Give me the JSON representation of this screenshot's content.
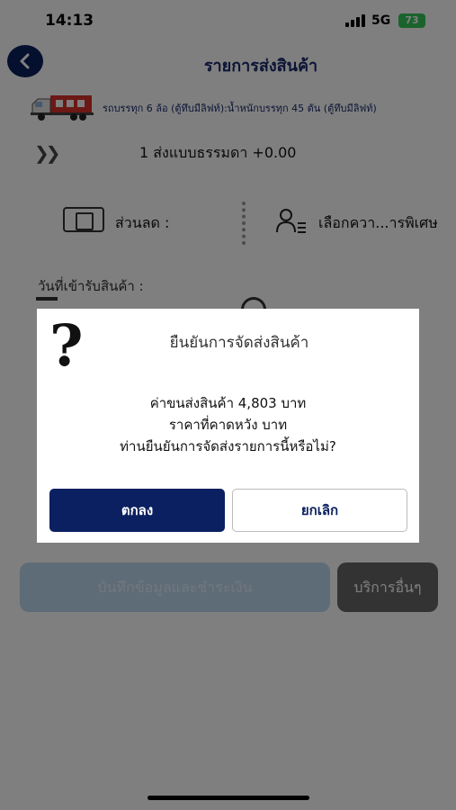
{
  "status": {
    "time": "14:13",
    "network": "5G",
    "battery": "73"
  },
  "header": {
    "title": "รายการส่งสินค้า"
  },
  "vehicle": {
    "description": "รถบรรทุก 6 ล้อ (ตู้ทึบมีลิฟท์):น้ำหนักบรรทุก 45 ตัน (ตู้ทึบมีลิฟท์)"
  },
  "delivery": {
    "option": "1 ส่งแบบธรรมดา +0.00"
  },
  "discount": {
    "label": "ส่วนลด :"
  },
  "options": {
    "label": "เลือกควา...ารพิเศษ"
  },
  "pickup": {
    "label": "วันที่เข้ารับสินค้า :"
  },
  "buttons": {
    "save_pay": "บันทึกข้อมูลและชำระเงิน",
    "other": "บริการอื่นๆ"
  },
  "dialog": {
    "icon": "?",
    "title": "ยืนยันการจัดส่งสินค้า",
    "line1": "ค่าขนส่งสินค้า 4,803 บาท",
    "line2": "ราคาที่คาดหวัง  บาท",
    "line3": "ท่านยืนยันการจัดส่งรายการนี้หรือไม่?",
    "ok": "ตกลง",
    "cancel": "ยกเลิก"
  },
  "colors": {
    "primary": "#0b2060",
    "battery": "#34c759",
    "overlay": "rgba(0,0,0,0.5)"
  }
}
